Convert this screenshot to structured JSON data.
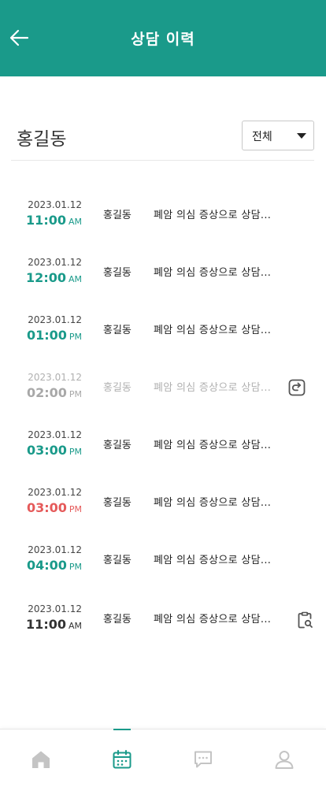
{
  "header": {
    "title": "상담 이력"
  },
  "patient": {
    "name": "홍길동"
  },
  "filter": {
    "selected": "전체"
  },
  "records": [
    {
      "date": "2023.01.12",
      "time": "11:00",
      "ampm": "AM",
      "name": "홍길동",
      "desc": "폐암 의심 증상으로 상담...",
      "status": "teal"
    },
    {
      "date": "2023.01.12",
      "time": "12:00",
      "ampm": "AM",
      "name": "홍길동",
      "desc": "폐암 의심 증상으로 상담...",
      "status": "teal"
    },
    {
      "date": "2023.01.12",
      "time": "01:00",
      "ampm": "PM",
      "name": "홍길동",
      "desc": "폐암 의심 증상으로 상담...",
      "status": "teal"
    },
    {
      "date": "2023.01.12",
      "time": "02:00",
      "ampm": "PM",
      "name": "홍길동",
      "desc": "폐암 의심 증상으로 상담...",
      "status": "gray",
      "icon": "redo-icon"
    },
    {
      "date": "2023.01.12",
      "time": "03:00",
      "ampm": "PM",
      "name": "홍길동",
      "desc": "폐암 의심 증상으로 상담...",
      "status": "teal"
    },
    {
      "date": "2023.01.12",
      "time": "03:00",
      "ampm": "PM",
      "name": "홍길동",
      "desc": "폐암 의심 증상으로 상담...",
      "status": "red"
    },
    {
      "date": "2023.01.12",
      "time": "04:00",
      "ampm": "PM",
      "name": "홍길동",
      "desc": "폐암 의심 증상으로 상담...",
      "status": "teal"
    },
    {
      "date": "2023.01.12",
      "time": "11:00",
      "ampm": "AM",
      "name": "홍길동",
      "desc": "폐암 의심 증상으로 상담...",
      "status": "dark",
      "icon": "clipboard-search-icon"
    }
  ],
  "nav": [
    {
      "icon": "home-icon",
      "active": false
    },
    {
      "icon": "calendar-icon",
      "active": true
    },
    {
      "icon": "chat-icon",
      "active": false
    },
    {
      "icon": "profile-icon",
      "active": false
    }
  ],
  "colors": {
    "brand": "#1a9a8a",
    "alert": "#e55a5a",
    "muted": "#a8a8a8"
  }
}
